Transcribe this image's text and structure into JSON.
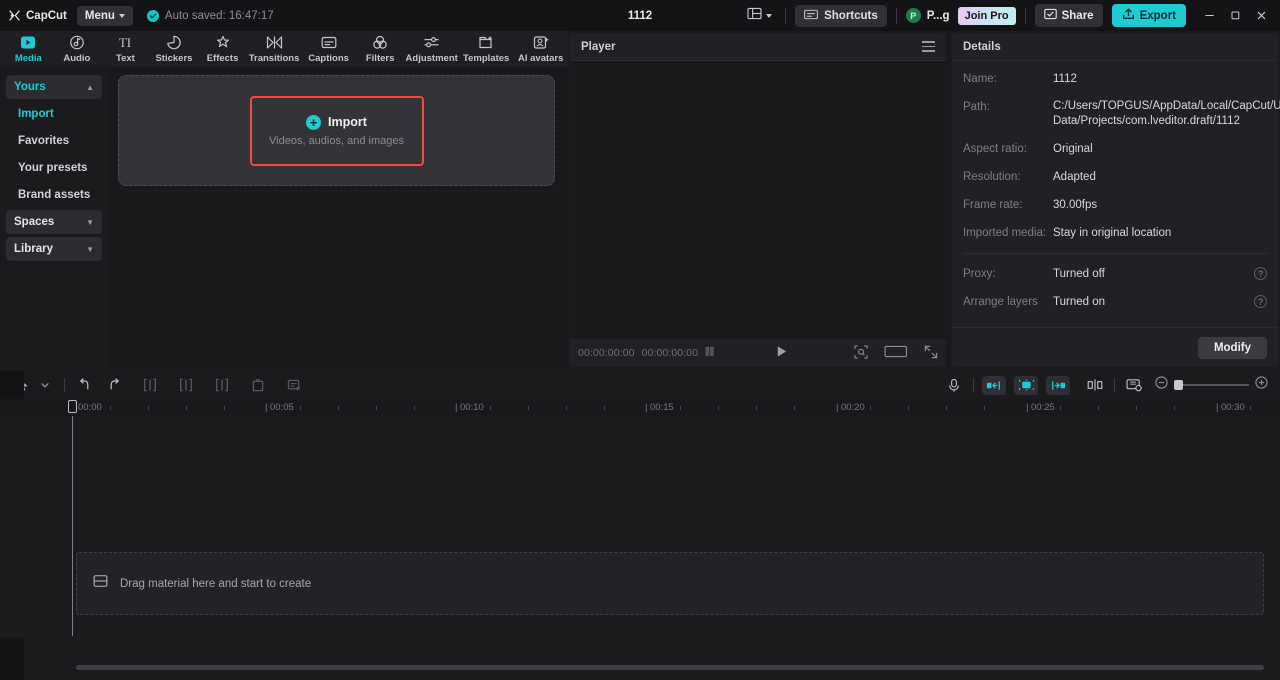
{
  "app": {
    "brand": "CapCut",
    "menu_label": "Menu",
    "autosave": "Auto saved: 16:47:17",
    "project_title": "1112",
    "accent": "#1ecbd3",
    "highlight": "#f5493d"
  },
  "titlebar": {
    "layout_icon": "layout-icon",
    "shortcuts_label": "Shortcuts",
    "account_initial": "P",
    "account_name": "P...g",
    "join_pro_label": "Join Pro",
    "share_label": "Share",
    "export_label": "Export",
    "minimize": "minimize-icon",
    "maximize": "maximize-icon",
    "close": "close-icon"
  },
  "tabs": [
    {
      "label": "Media",
      "icon": "media-icon",
      "active": true
    },
    {
      "label": "Audio",
      "icon": "audio-icon",
      "active": false
    },
    {
      "label": "Text",
      "icon": "text-icon",
      "active": false
    },
    {
      "label": "Stickers",
      "icon": "stickers-icon",
      "active": false
    },
    {
      "label": "Effects",
      "icon": "effects-icon",
      "active": false
    },
    {
      "label": "Transitions",
      "icon": "transitions-icon",
      "active": false
    },
    {
      "label": "Captions",
      "icon": "captions-icon",
      "active": false
    },
    {
      "label": "Filters",
      "icon": "filters-icon",
      "active": false
    },
    {
      "label": "Adjustment",
      "icon": "adjustment-icon",
      "active": false
    },
    {
      "label": "Templates",
      "icon": "templates-icon",
      "active": false
    },
    {
      "label": "AI avatars",
      "icon": "ai-avatars-icon",
      "active": false
    }
  ],
  "sidebar": {
    "items": [
      {
        "label": "Yours",
        "type": "group",
        "expanded": true,
        "chevron": "▲"
      },
      {
        "label": "Import",
        "type": "sub",
        "active": true
      },
      {
        "label": "Favorites",
        "type": "sub",
        "active": false
      },
      {
        "label": "Your presets",
        "type": "sub",
        "active": false
      },
      {
        "label": "Brand assets",
        "type": "sub",
        "active": false
      },
      {
        "label": "Spaces",
        "type": "group",
        "expanded": false,
        "chevron": "▼"
      },
      {
        "label": "Library",
        "type": "group",
        "expanded": false,
        "chevron": "▼"
      }
    ]
  },
  "media": {
    "import_label": "Import",
    "import_subtitle": "Videos, audios, and images",
    "plus_icon": "plus-icon"
  },
  "player": {
    "title": "Player",
    "menu_icon": "hamburger-icon",
    "current_time": "00:00:00:00",
    "total_time": "00:00:00:00",
    "play_icon": "play-icon",
    "quality_icon": "quality-icon",
    "crop_icon": "crop-focus-icon",
    "ratio_icon": "aspect-ratio-icon",
    "fullscreen_icon": "fullscreen-icon"
  },
  "details": {
    "title": "Details",
    "rows": [
      {
        "label": "Name:",
        "value": "1112",
        "help": false
      },
      {
        "label": "Path:",
        "value": "C:/Users/TOPGUS/AppData/Local/CapCut/User Data/Projects/com.lveditor.draft/1112",
        "help": false
      },
      {
        "label": "Aspect ratio:",
        "value": "Original",
        "help": false
      },
      {
        "label": "Resolution:",
        "value": "Adapted",
        "help": false
      },
      {
        "label": "Frame rate:",
        "value": "30.00fps",
        "help": false
      },
      {
        "label": "Imported media:",
        "value": "Stay in original location",
        "help": false
      }
    ],
    "rows2": [
      {
        "label": "Proxy:",
        "value": "Turned off",
        "help": true
      },
      {
        "label": "Arrange layers",
        "value": "Turned on",
        "help": true
      }
    ],
    "modify_label": "Modify"
  },
  "timeline": {
    "tools": [
      {
        "name": "select-tool",
        "icon": "cursor-icon"
      },
      {
        "name": "select-dropdown",
        "icon": "chevron-down-icon"
      },
      {
        "name": "undo-button",
        "icon": "undo-icon"
      },
      {
        "name": "redo-button",
        "icon": "redo-icon"
      },
      {
        "name": "split-button",
        "icon": "split-icon"
      },
      {
        "name": "trim-left-button",
        "icon": "trim-left-icon"
      },
      {
        "name": "trim-right-button",
        "icon": "trim-right-icon"
      },
      {
        "name": "delete-button",
        "icon": "trash-icon"
      },
      {
        "name": "crop-button",
        "icon": "crop-icon"
      }
    ],
    "right_tools": [
      {
        "name": "record-voiceover-button",
        "icon": "microphone-icon"
      },
      {
        "name": "keyframe-prev-button",
        "icon": "keyframe-prev-icon"
      },
      {
        "name": "keyframe-add-button",
        "icon": "keyframe-add-icon"
      },
      {
        "name": "keyframe-next-button",
        "icon": "keyframe-next-icon"
      },
      {
        "name": "mirror-button",
        "icon": "mirror-icon"
      },
      {
        "name": "preview-thumbnail-button",
        "icon": "thumbnail-icon"
      },
      {
        "name": "zoom-out-button",
        "icon": "zoom-out-icon"
      },
      {
        "name": "zoom-in-button",
        "icon": "zoom-in-icon"
      }
    ],
    "ruler_labels": [
      "00:00",
      "00:05",
      "00:10",
      "00:15",
      "00:20",
      "00:25",
      "00:30"
    ],
    "drop_hint": "Drag material here and start to create",
    "drop_icon": "track-icon"
  }
}
